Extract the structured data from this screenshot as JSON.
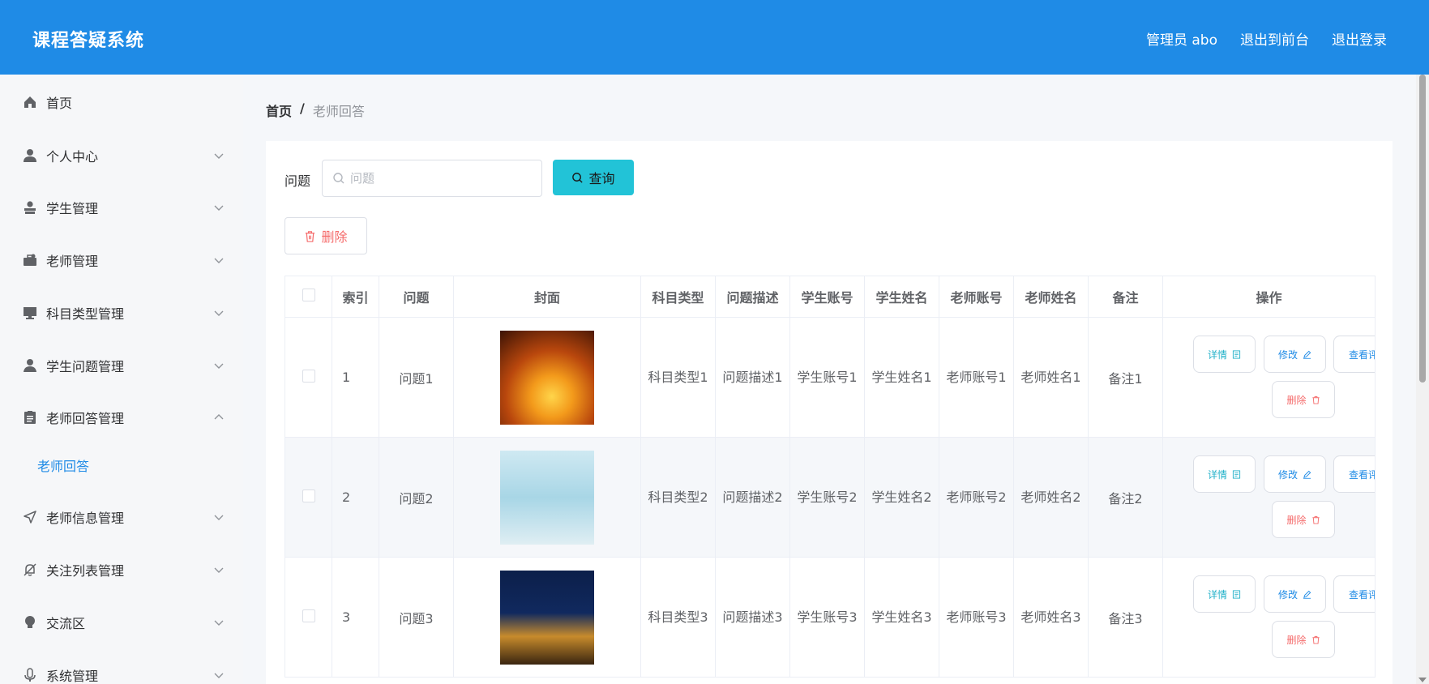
{
  "app": {
    "title": "课程答疑系统"
  },
  "header": {
    "user": "管理员 abo",
    "to_front": "退出到前台",
    "logout": "退出登录"
  },
  "sidebar": {
    "items": [
      {
        "label": "首页",
        "icon": "home-icon"
      },
      {
        "label": "个人中心",
        "icon": "user-icon"
      },
      {
        "label": "学生管理",
        "icon": "student-icon"
      },
      {
        "label": "老师管理",
        "icon": "briefcase-icon"
      },
      {
        "label": "科目类型管理",
        "icon": "monitor-icon"
      },
      {
        "label": "学生问题管理",
        "icon": "person-icon"
      },
      {
        "label": "老师回答管理",
        "icon": "clipboard-icon"
      },
      {
        "label": "老师信息管理",
        "icon": "send-icon"
      },
      {
        "label": "关注列表管理",
        "icon": "bell-off-icon"
      },
      {
        "label": "交流区",
        "icon": "bulb-icon"
      },
      {
        "label": "系统管理",
        "icon": "mic-icon"
      }
    ],
    "subitem": "老师回答"
  },
  "breadcrumb": {
    "home": "首页",
    "sep": "/",
    "current": "老师回答"
  },
  "search": {
    "label": "问题",
    "placeholder": "问题",
    "query_button": "查询"
  },
  "toolbar": {
    "delete_button": "删除"
  },
  "table": {
    "columns": [
      "索引",
      "问题",
      "封面",
      "科目类型",
      "问题描述",
      "学生账号",
      "学生姓名",
      "老师账号",
      "老师姓名",
      "备注",
      "操作"
    ],
    "rows": [
      {
        "index": "1",
        "question": "问题1",
        "subject": "科目类型1",
        "desc": "问题描述1",
        "stu_acct": "学生账号1",
        "stu_name": "学生姓名1",
        "tea_acct": "老师账号1",
        "tea_name": "老师姓名1",
        "note": "备注1"
      },
      {
        "index": "2",
        "question": "问题2",
        "subject": "科目类型2",
        "desc": "问题描述2",
        "stu_acct": "学生账号2",
        "stu_name": "学生姓名2",
        "tea_acct": "老师账号2",
        "tea_name": "老师姓名2",
        "note": "备注2"
      },
      {
        "index": "3",
        "question": "问题3",
        "subject": "科目类型3",
        "desc": "问题描述3",
        "stu_acct": "学生账号3",
        "stu_name": "学生姓名3",
        "tea_acct": "老师账号3",
        "tea_name": "老师姓名3",
        "note": "备注3"
      }
    ],
    "actions": {
      "detail": "详情",
      "edit": "修改",
      "view": "查看评",
      "delete": "删除"
    }
  },
  "colors": {
    "primary": "#1f8be6",
    "cyan": "#22c3d7",
    "danger": "#f56c6c"
  }
}
